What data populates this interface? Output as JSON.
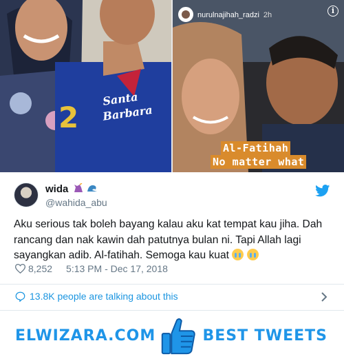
{
  "photos": {
    "story_username": "nurulnajihah_radzi",
    "story_time": "2h",
    "overlay_line1": "Al-Fatihah",
    "overlay_line2": "No matter what",
    "left_shirt_text": "Santa Barbara"
  },
  "tweet": {
    "display_name": "wida",
    "handle": "@wahida_abu",
    "text": "Aku serious tak boleh bayang kalau aku kat tempat kau jiha. Dah rancang dan nak kawin dah patutnya bulan ni. Tapi Allah lagi sayangkan adib. Al-fatihah. Semoga kau kuat",
    "likes": "8,252",
    "timestamp": "5:13 PM - Dec 17, 2018",
    "talking": "13.8K people are talking about this"
  },
  "footer": {
    "brand_left": "ELWIZARA.COM",
    "brand_right": "BEST TWEETS"
  },
  "colors": {
    "twitter_blue": "#1da1f2",
    "link_blue": "#1b95e0",
    "brand_blue": "#1f95e8",
    "overlay_orange": "#d98b2c"
  }
}
